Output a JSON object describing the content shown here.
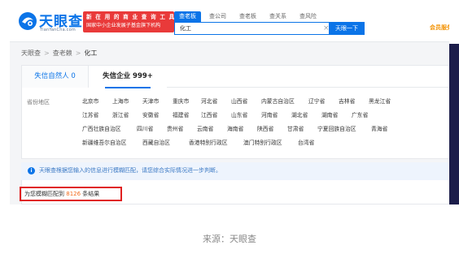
{
  "header": {
    "logo_text": "天眼查",
    "logo_sub": "TianYanCha.com",
    "banner_line1": "新 在 用 的 商 业 查 询 工 具",
    "banner_line2": "国家中小企业发展子基金旗下机构",
    "search_tabs": [
      "查老板",
      "查公司",
      "查老板",
      "查关系",
      "查风险"
    ],
    "search_value": "化工",
    "search_button": "天眼一下",
    "member_link": "会员服务"
  },
  "breadcrumb": [
    "天眼查",
    "查老赖",
    "化工"
  ],
  "tabs": [
    {
      "label": "失信自然人 0"
    },
    {
      "label": "失信企业 999+"
    }
  ],
  "filter_label": "省份地区",
  "regions": [
    [
      "北京市",
      "上海市",
      "天津市",
      "重庆市",
      "河北省",
      "山西省",
      "内蒙古自治区",
      "辽宁省",
      "吉林省",
      "黑龙江省"
    ],
    [
      "江苏省",
      "浙江省",
      "安徽省",
      "福建省",
      "江西省",
      "山东省",
      "河南省",
      "湖北省",
      "湖南省",
      "广东省"
    ],
    [
      "广西壮族自治区",
      "四川省",
      "贵州省",
      "云南省",
      "海南省",
      "陕西省",
      "甘肃省",
      "宁夏回族自治区",
      "青海省"
    ],
    [
      "新疆维吾尔自治区",
      "西藏自治区",
      "香港特别行政区",
      "澳门特别行政区",
      "台湾省"
    ]
  ],
  "notice": "天眼查根据您输入的信息进行模糊匹配，请您综合实际情况进一步判断。",
  "result": {
    "prefix": "为您模糊匹配到",
    "count": "8126",
    "suffix": "条结果"
  },
  "caption": "来源：天眼查",
  "colors": {
    "accent": "#0b74e8",
    "banner": "#e93a3a",
    "highlight_box": "#e02020",
    "count": "#f26b1d"
  }
}
